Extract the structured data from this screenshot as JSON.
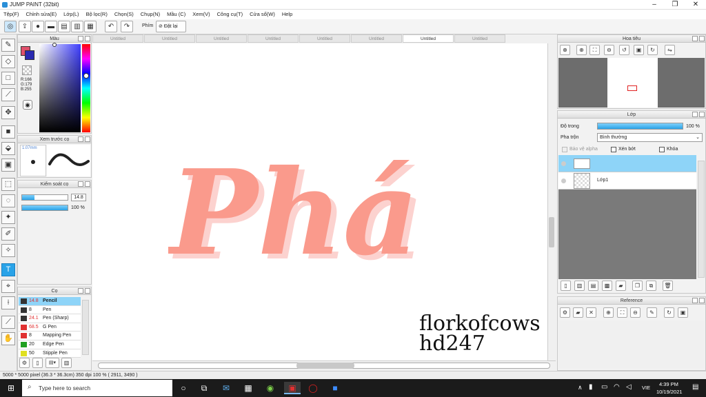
{
  "window": {
    "title": "JUMP PAINT (32bit)"
  },
  "menu": [
    "Tệp(F)",
    "Chỉnh sửa(E)",
    "Lớp(L)",
    "Bộ lọc(R)",
    "Chọn(S)",
    "Chụp(N)",
    "Mầu (C)",
    "Xem(V)",
    "Công cụ(T)",
    "Cửa sổ(W)",
    "Help"
  ],
  "toolbar": {
    "phim_label": "Phím",
    "reset_label": "Đặt lại"
  },
  "tabs": [
    "Untitled",
    "Untitled",
    "Untitled",
    "Untitled",
    "Untitled",
    "Untitled",
    "Untitled",
    "Untitled"
  ],
  "color_panel": {
    "title": "Màu",
    "r": "R:166",
    "g": "G:179",
    "b": "B:255",
    "fg": "#e0506c",
    "bg": "#2a2ab0"
  },
  "preview_panel": {
    "title": "Xem trước cọ",
    "size": "1.07mm"
  },
  "control_panel": {
    "title": "Kiểm soát cọ",
    "size": "14.8",
    "opacity": "100 %"
  },
  "brush_panel": {
    "title": "Cọ",
    "brushes": [
      {
        "size": "14.8",
        "name": "Pencil",
        "color": "#333333"
      },
      {
        "size": "8",
        "name": "Pen",
        "color": "#333333"
      },
      {
        "size": "24.1",
        "name": "Pen (Sharp)",
        "color": "#333333"
      },
      {
        "size": "68.5",
        "name": "G Pen",
        "color": "#e03030"
      },
      {
        "size": "8",
        "name": "Mapping Pen",
        "color": "#e03030"
      },
      {
        "size": "20",
        "name": "Edge Pen",
        "color": "#20a020"
      },
      {
        "size": "50",
        "name": "Stipple Pen",
        "color": "#e0e020"
      }
    ]
  },
  "navigator_panel": {
    "title": "Hoa tiêu"
  },
  "layer_panel": {
    "title": "Lớp",
    "opacity_label": "Độ trong",
    "opacity_value": "100 %",
    "blend_label": "Pha trộn",
    "blend_value": "Bình thường",
    "protect_alpha": "Bảo vệ alpha",
    "clipping": "Xén bớt",
    "lock": "Khóa",
    "layers": [
      {
        "name": ""
      },
      {
        "name": "Lớp1"
      }
    ]
  },
  "reference_panel": {
    "title": "Reference"
  },
  "canvas": {
    "artwork_text": "Phá",
    "watermark_line1": "florkofcows",
    "watermark_line2": "hd247"
  },
  "status": {
    "text": "5000 * 5000 pixel  (36.3 * 36.3cm)  350 dpi  100 %  ( 2911, 3490 )"
  },
  "taskbar": {
    "search_placeholder": "Type here to search",
    "time": "4:39 PM",
    "date": "10/19/2021",
    "lang": "VIE"
  }
}
